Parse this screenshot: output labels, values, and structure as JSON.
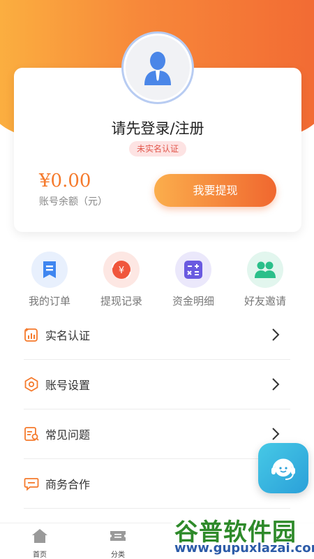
{
  "profile": {
    "login_prompt": "请先登录/注册",
    "verify_status": "未实名认证",
    "balance": "¥0.00",
    "balance_label": "账号余额（元）",
    "withdraw_label": "我要提现"
  },
  "quick_actions": [
    {
      "label": "我的订单",
      "icon": "orders-icon",
      "color": "#3f86f0"
    },
    {
      "label": "提现记录",
      "icon": "withdraw-record-icon",
      "color": "#f0563c"
    },
    {
      "label": "资金明细",
      "icon": "calculator-icon",
      "color": "#6a5ae0"
    },
    {
      "label": "好友邀请",
      "icon": "friends-icon",
      "color": "#2bbf8a"
    }
  ],
  "menu": [
    {
      "label": "实名认证",
      "icon": "verify-chart-icon"
    },
    {
      "label": "账号设置",
      "icon": "settings-icon"
    },
    {
      "label": "常见问题",
      "icon": "faq-icon"
    },
    {
      "label": "商务合作",
      "icon": "chat-icon"
    }
  ],
  "tabbar": [
    {
      "label": "首页",
      "icon": "home-icon"
    },
    {
      "label": "分类",
      "icon": "ticket-icon"
    }
  ],
  "watermark": {
    "brand": "谷普软件园",
    "url": "www.gupuxlazai.com"
  },
  "colors": {
    "accent": "#f57a2c",
    "badge_bg": "#fde3e3",
    "badge_text": "#e2574c"
  }
}
